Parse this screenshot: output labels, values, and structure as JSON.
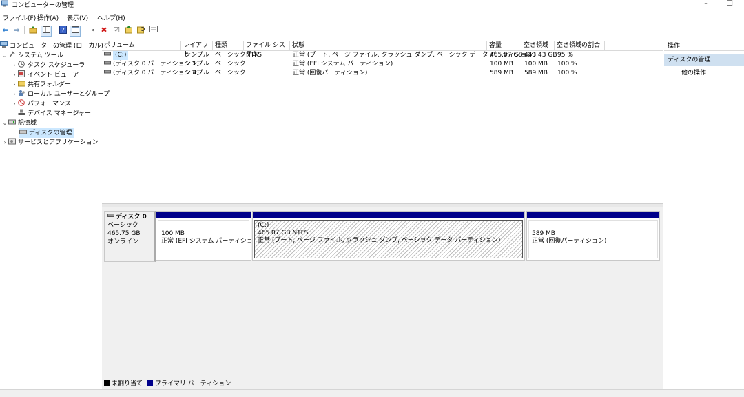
{
  "window": {
    "title": "コンピューターの管理",
    "minimize": "–",
    "maximize": "☐"
  },
  "menu": [
    "ファイル(F)",
    "操作(A)",
    "表示(V)",
    "ヘルプ(H)"
  ],
  "toolbar_icons": [
    "back-icon",
    "forward-icon",
    "up-icon",
    "show-hide-tree-icon",
    "help-icon",
    "console-icon",
    "connect-icon",
    "delete-icon",
    "properties-icon",
    "open-icon",
    "search-icon",
    "view-icon"
  ],
  "tree": {
    "root": "コンピューターの管理 (ローカル)",
    "system_tools": "システム ツール",
    "task_scheduler": "タスク スケジューラ",
    "event_viewer": "イベント ビューアー",
    "shared_folders": "共有フォルダー",
    "local_users": "ローカル ユーザーとグループ",
    "performance": "パフォーマンス",
    "device_manager": "デバイス マネージャー",
    "storage": "記憶域",
    "disk_management": "ディスクの管理",
    "services": "サービスとアプリケーション"
  },
  "columns": [
    "ボリューム",
    "レイアウト",
    "種類",
    "ファイル システム",
    "状態",
    "容量",
    "空き領域",
    "空き領域の割合"
  ],
  "volumes": [
    {
      "name": "(C:)",
      "layout": "シンプル",
      "type": "ベーシック",
      "fs": "NTFS",
      "status": "正常 (ブート, ページ ファイル, クラッシュ ダンプ, ベーシック データ パーティション)",
      "capacity": "465.07 GB",
      "free": "443.43 GB",
      "pct": "95 %"
    },
    {
      "name": "(ディスク 0 パーティション 1)",
      "layout": "シンプル",
      "type": "ベーシック",
      "fs": "",
      "status": "正常 (EFI システム パーティション)",
      "capacity": "100 MB",
      "free": "100 MB",
      "pct": "100 %"
    },
    {
      "name": "(ディスク 0 パーティション 4)",
      "layout": "シンプル",
      "type": "ベーシック",
      "fs": "",
      "status": "正常 (回復パーティション)",
      "capacity": "589 MB",
      "free": "589 MB",
      "pct": "100 %"
    }
  ],
  "disk": {
    "label": "ディスク 0",
    "kind": "ベーシック",
    "size": "465.75 GB",
    "state": "オンライン",
    "partitions": [
      {
        "name": "",
        "size": "100 MB",
        "status": "正常 (EFI システム パーティション)"
      },
      {
        "name": "(C:)",
        "size": "465.07 GB NTFS",
        "status": "正常 (ブート, ページ ファイル, クラッシュ ダンプ, ベーシック データ パーティション)"
      },
      {
        "name": "",
        "size": "589 MB",
        "status": "正常 (回復パーティション)"
      }
    ]
  },
  "legend": {
    "unallocated": "未割り当て",
    "primary": "プライマリ パーティション",
    "unallocated_color": "#000000",
    "primary_color": "#00008b"
  },
  "actions": {
    "header": "操作",
    "section": "ディスクの管理",
    "other": "他の操作"
  }
}
